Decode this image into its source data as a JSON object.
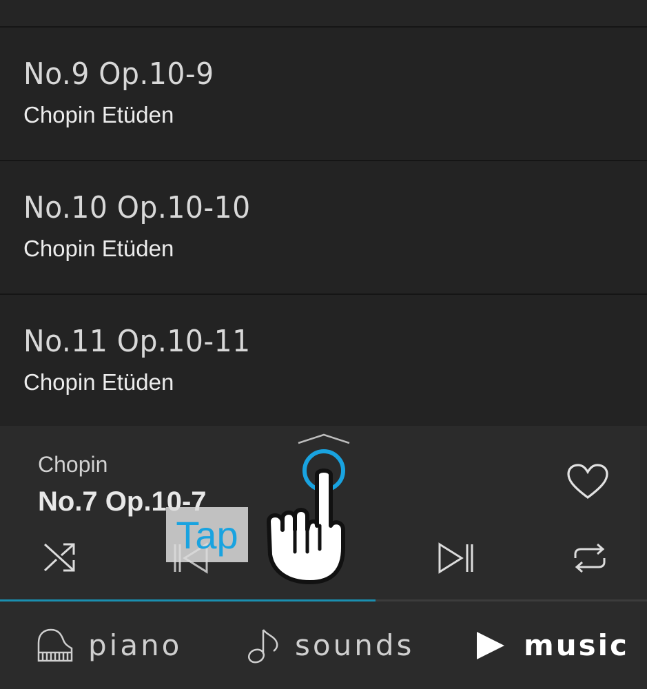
{
  "list": {
    "items": [
      {
        "title": "No.9 Op.10-9",
        "subtitle": "Chopin Etüden"
      },
      {
        "title": "No.10 Op.10-10",
        "subtitle": "Chopin Etüden"
      },
      {
        "title": "No.11 Op.10-11",
        "subtitle": "Chopin Etüden"
      }
    ]
  },
  "now_playing": {
    "artist": "Chopin",
    "title": "No.7 Op.10-7",
    "progress": 0.58
  },
  "icons": {
    "expand": "chevron-up-icon",
    "favorite": "heart-icon",
    "shuffle": "shuffle-icon",
    "previous": "skip-previous-icon",
    "next": "skip-next-icon",
    "repeat": "repeat-icon"
  },
  "tutorial": {
    "tap_label": "Tap"
  },
  "nav": {
    "piano": "piano",
    "sounds": "sounds",
    "music": "music",
    "active": "music"
  },
  "colors": {
    "accent": "#1a8fb0",
    "tap_blue": "#19a3e0",
    "background": "#232323",
    "player_bg": "#2b2b2b"
  }
}
